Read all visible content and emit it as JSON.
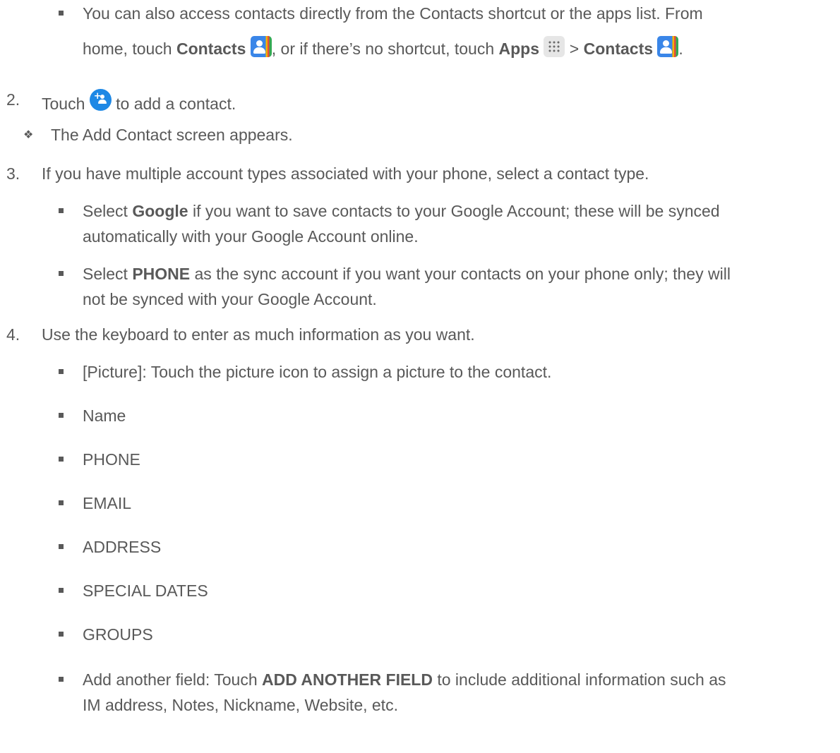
{
  "intro_bullet": {
    "line1": "You can also access contacts directly from the Contacts shortcut or the apps list. From",
    "line2_a": "home, touch ",
    "contacts_bold_1": "Contacts",
    "line2_b": ", or if there’s no shortcut, touch ",
    "apps_bold": "Apps",
    "gt": " > ",
    "contacts_bold_2": "Contacts",
    "period": "."
  },
  "steps": [
    {
      "number": "2.",
      "text_a": "Touch ",
      "text_b": " to add a contact.",
      "result": "The Add Contact screen appears."
    },
    {
      "number": "3.",
      "text": "If you have multiple account types associated with your phone, select a contact type.",
      "bullets": [
        {
          "prefix": "Select ",
          "bold": "Google",
          "line1": " if you want to save contacts to your Google Account; these will be synced",
          "line2": "automatically with your Google Account online."
        },
        {
          "prefix": "Select ",
          "bold": "PHONE",
          "line1": " as the sync account if you want your contacts on your phone only; they will",
          "line2": "not be synced with your Google Account."
        }
      ]
    },
    {
      "number": "4.",
      "text": "Use the keyboard to enter as much information as you want.",
      "fields": [
        "[Picture]: Touch the picture icon to assign a picture to the contact.",
        "Name",
        "PHONE",
        "EMAIL",
        "ADDRESS",
        "SPECIAL DATES",
        "GROUPS"
      ],
      "another": {
        "prefix": "Add another field: Touch ",
        "bold": "ADD ANOTHER FIELD",
        "line1": " to include additional information such as",
        "line2": "IM address, Notes, Nickname, Website, etc."
      }
    }
  ],
  "icons": {
    "contacts": "contacts-app-icon",
    "apps": "apps-grid-icon",
    "add_contact": "add-contact-icon"
  },
  "colors": {
    "text": "#595959",
    "add_contact_blue": "#1e88e5",
    "contacts_blue": "#3a86e8"
  }
}
